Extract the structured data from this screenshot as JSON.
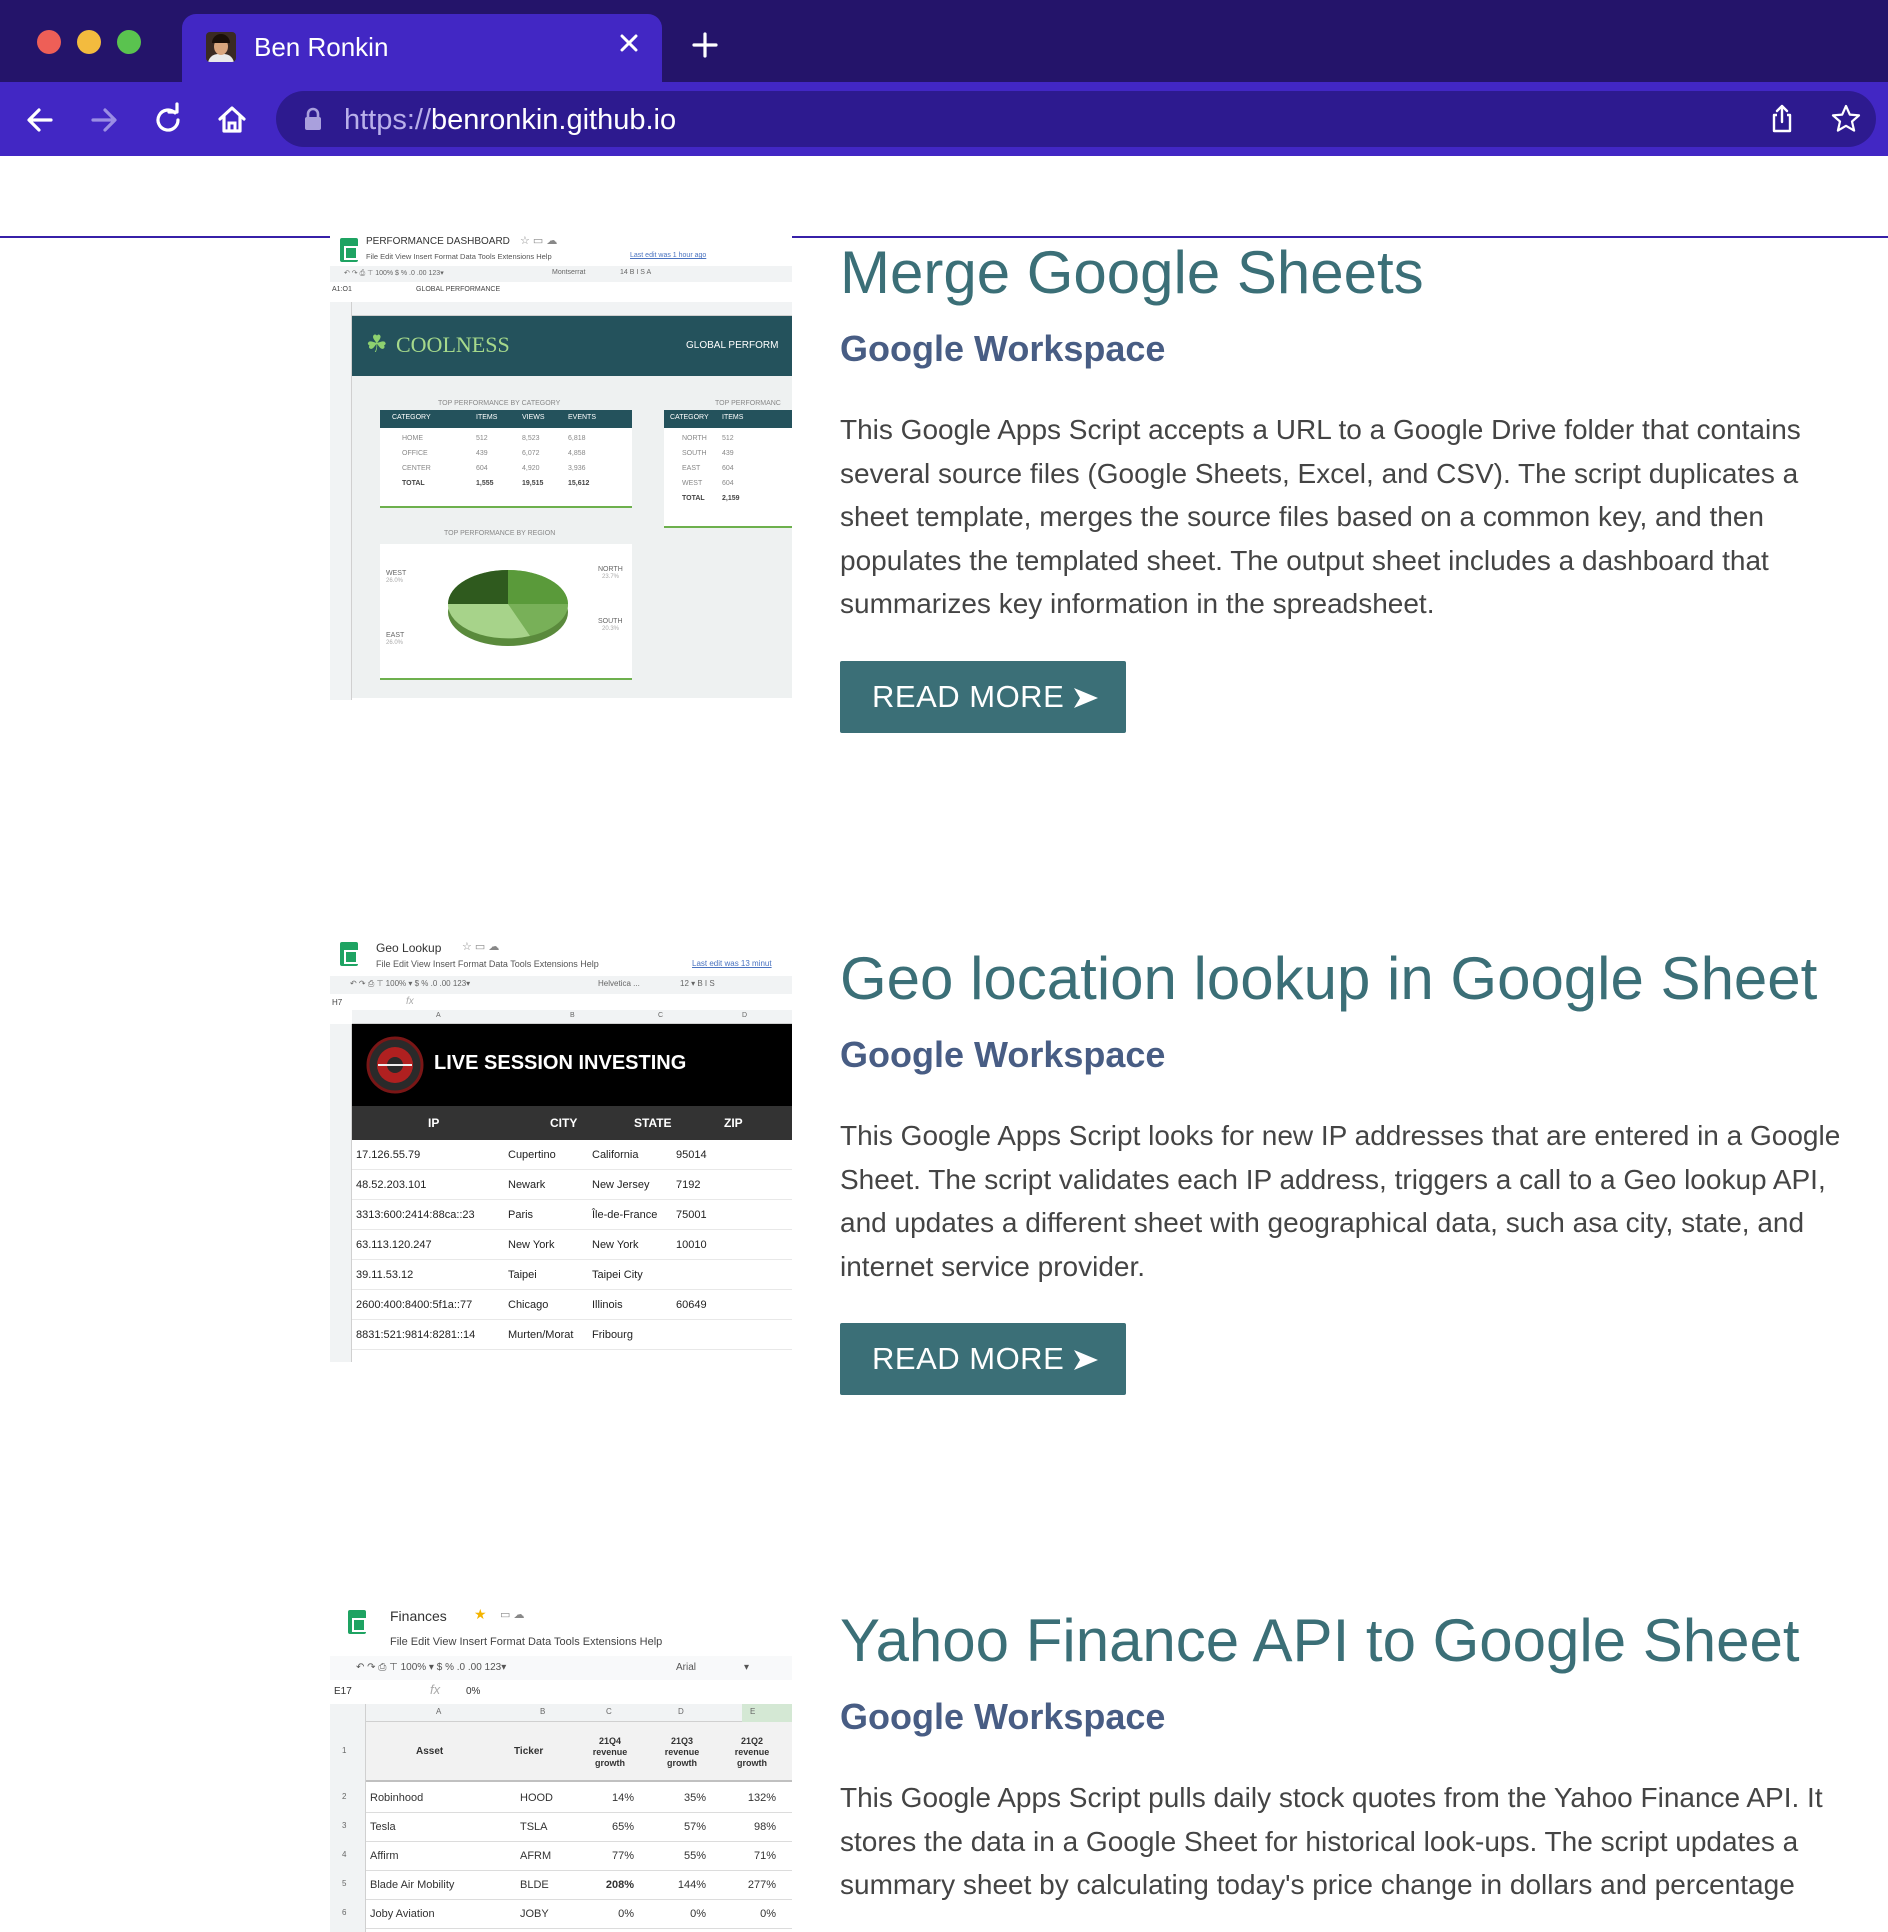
{
  "browser": {
    "tab_title": "Ben Ronkin",
    "url_scheme": "https://",
    "url_host": "benronkin.github.io"
  },
  "posts": [
    {
      "title": "Merge Google Sheets",
      "category": "Google Workspace",
      "description": "This Google Apps Script accepts a URL to a Google Drive folder that contains several source files (Google Sheets, Excel, and CSV). The script duplicates a sheet template, merges the source files based on a common key, and then populates the templated sheet. The output sheet includes a dashboard that summarizes key information in the spreadsheet.",
      "button": "READ MORE",
      "thumbnail": {
        "doc_name": "PERFORMANCE DASHBOARD",
        "menu": "File  Edit  View  Insert  Format  Data  Tools  Extensions  Help",
        "last_edit": "Last edit was 1 hour ago",
        "cell_ref": "A1:O1",
        "formula": "GLOBAL PERFORMANCE",
        "font": "Montserrat",
        "banner_title": "COOLNESS",
        "banner_right": "GLOBAL PERFORM",
        "table1_caption": "TOP PERFORMANCE BY CATEGORY",
        "table1_headers": [
          "CATEGORY",
          "ITEMS",
          "VIEWS",
          "EVENTS"
        ],
        "table1_rows": [
          [
            "HOME",
            "512",
            "8,523",
            "6,818"
          ],
          [
            "OFFICE",
            "439",
            "6,072",
            "4,858"
          ],
          [
            "CENTER",
            "604",
            "4,920",
            "3,936"
          ],
          [
            "TOTAL",
            "1,555",
            "19,515",
            "15,612"
          ]
        ],
        "table2_caption": "TOP PERFORMANC",
        "table2_headers": [
          "CATEGORY",
          "ITEMS"
        ],
        "table2_rows": [
          [
            "NORTH",
            "512"
          ],
          [
            "SOUTH",
            "439"
          ],
          [
            "EAST",
            "604"
          ],
          [
            "WEST",
            "604"
          ],
          [
            "TOTAL",
            "2,159"
          ]
        ],
        "pie_caption": "TOP PERFORMANCE BY REGION",
        "pie_labels": [
          {
            "name": "WEST",
            "pct": "26.0%"
          },
          {
            "name": "NORTH",
            "pct": "23.7%"
          },
          {
            "name": "EAST",
            "pct": "26.0%"
          },
          {
            "name": "SOUTH",
            "pct": "20.3%"
          }
        ]
      }
    },
    {
      "title": "Geo location lookup in Google Sheet",
      "category": "Google Workspace",
      "description": "This Google Apps Script looks for new IP addresses that are entered in a Google Sheet. The script validates each IP address, triggers a call to a Geo lookup API, and updates a different sheet with geographical data, such asa city, state, and internet service provider.",
      "button": "READ MORE",
      "thumbnail": {
        "doc_name": "Geo Lookup",
        "menu": "File  Edit  View  Insert  Format  Data  Tools  Extensions  Help",
        "last_edit": "Last edit was 13 minut",
        "cell_ref": "H7",
        "font": "Helvetica ...",
        "banner_title": "LIVE SESSION INVESTING",
        "headers": [
          "IP",
          "CITY",
          "STATE",
          "ZIP"
        ],
        "rows": [
          [
            "17.126.55.79",
            "Cupertino",
            "California",
            "95014"
          ],
          [
            "48.52.203.101",
            "Newark",
            "New Jersey",
            "7192"
          ],
          [
            "3313:600:2414:88ca::23",
            "Paris",
            "Île-de-France",
            "75001"
          ],
          [
            "63.113.120.247",
            "New York",
            "New York",
            "10010"
          ],
          [
            "39.11.53.12",
            "Taipei",
            "Taipei City",
            ""
          ],
          [
            "2600:400:8400:5f1a::77",
            "Chicago",
            "Illinois",
            "60649"
          ],
          [
            "8831:521:9814:8281::14",
            "Murten/Morat",
            "Fribourg",
            ""
          ]
        ]
      }
    },
    {
      "title": "Yahoo Finance API to Google Sheet",
      "category": "Google Workspace",
      "description": "This Google Apps Script pulls daily stock quotes from the Yahoo Finance API. It stores the data in a Google Sheet for historical look-ups. The script updates a summary sheet by calculating today's price change in dollars and percentage",
      "button": "READ MORE",
      "thumbnail": {
        "doc_name": "Finances",
        "menu": "File  Edit  View  Insert  Format  Data  Tools  Extensions  Help",
        "cell_ref": "E17",
        "formula": "0%",
        "font": "Arial",
        "headers": [
          "Asset",
          "Ticker",
          "21Q4 revenue growth",
          "21Q3 revenue growth",
          "21Q2 revenue growth"
        ],
        "rows": [
          [
            "Robinhood",
            "HOOD",
            "14%",
            "35%",
            "132%"
          ],
          [
            "Tesla",
            "TSLA",
            "65%",
            "57%",
            "98%"
          ],
          [
            "Affirm",
            "AFRM",
            "77%",
            "55%",
            "71%"
          ],
          [
            "Blade Air Mobility",
            "BLDE",
            "208%",
            "144%",
            "277%"
          ],
          [
            "Joby Aviation",
            "JOBY",
            "0%",
            "0%",
            "0%"
          ]
        ]
      }
    }
  ],
  "colors": {
    "tabbar": "#24146a",
    "toolbar": "#4227c4",
    "title": "#3b6f77",
    "category": "#485d84",
    "button": "#3b6f77",
    "sheets_green": "#1ea362"
  }
}
